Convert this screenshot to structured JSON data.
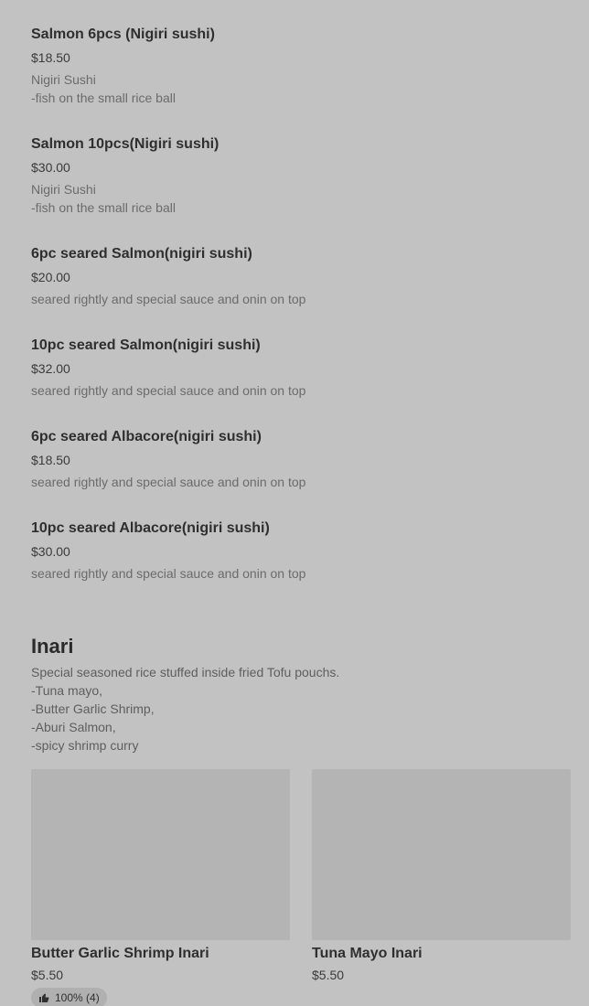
{
  "menu_items": [
    {
      "name": "Salmon 6pcs (Nigiri sushi)",
      "price": "$18.50",
      "description": "Nigiri Sushi\n-fish on the small rice ball"
    },
    {
      "name": "Salmon 10pcs(Nigiri sushi)",
      "price": "$30.00",
      "description": "Nigiri Sushi\n-fish on the small rice ball"
    },
    {
      "name": "6pc seared Salmon(nigiri sushi)",
      "price": "$20.00",
      "description": "seared rightly and special sauce and onin on top"
    },
    {
      "name": "10pc seared Salmon(nigiri sushi)",
      "price": "$32.00",
      "description": "seared rightly and special sauce and onin on top"
    },
    {
      "name": "6pc seared Albacore(nigiri sushi)",
      "price": "$18.50",
      "description": "seared rightly and special sauce and onin on top"
    },
    {
      "name": "10pc seared Albacore(nigiri sushi)",
      "price": "$30.00",
      "description": "seared rightly and special sauce and onin on top"
    }
  ],
  "inari_section": {
    "title": "Inari",
    "description": "Special seasoned rice stuffed inside fried Tofu pouchs.\n-Tuna mayo,\n-Butter Garlic Shrimp,\n-Aburi Salmon,\n-spicy shrimp curry",
    "cards": [
      {
        "name": "Butter Garlic Shrimp Inari",
        "price": "$5.50",
        "rating": "100% (4)",
        "image_icon": "food-photo-placeholder",
        "rating_icon": "thumbs-up-icon"
      },
      {
        "name": "Tuna Mayo Inari",
        "price": "$5.50",
        "image_icon": "food-photo-placeholder"
      }
    ]
  },
  "colors": {
    "background": "#c2c2c2",
    "image_placeholder": "#b4b4b4",
    "badge_background": "#b0b0b0"
  }
}
